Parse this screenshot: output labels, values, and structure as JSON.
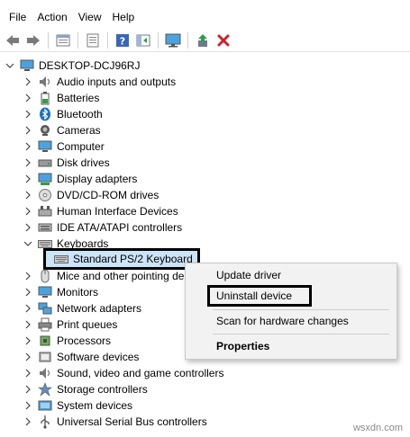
{
  "menubar": {
    "items": [
      "File",
      "Action",
      "View",
      "Help"
    ]
  },
  "toolbar": {
    "icons": [
      "back-arrow-icon",
      "forward-arrow-icon",
      "properties-icon",
      "device-list-icon",
      "help-icon",
      "show-hide-console-icon",
      "monitor-icon",
      "update-driver-icon",
      "uninstall-x-icon"
    ]
  },
  "tree": {
    "root": "DESKTOP-DCJ96RJ",
    "categories": [
      "Audio inputs and outputs",
      "Batteries",
      "Bluetooth",
      "Cameras",
      "Computer",
      "Disk drives",
      "Display adapters",
      "DVD/CD-ROM drives",
      "Human Interface Devices",
      "IDE ATA/ATAPI controllers",
      "Keyboards",
      "Mice and other pointing de",
      "Monitors",
      "Network adapters",
      "Print queues",
      "Processors",
      "Software devices",
      "Sound, video and game controllers",
      "Storage controllers",
      "System devices",
      "Universal Serial Bus controllers"
    ],
    "keyboard_child": "Standard PS/2 Keyboard"
  },
  "context_menu": {
    "update_driver": "Update driver",
    "uninstall_device": "Uninstall device",
    "scan": "Scan for hardware changes",
    "properties": "Properties"
  },
  "watermark": "wsxdn.com"
}
